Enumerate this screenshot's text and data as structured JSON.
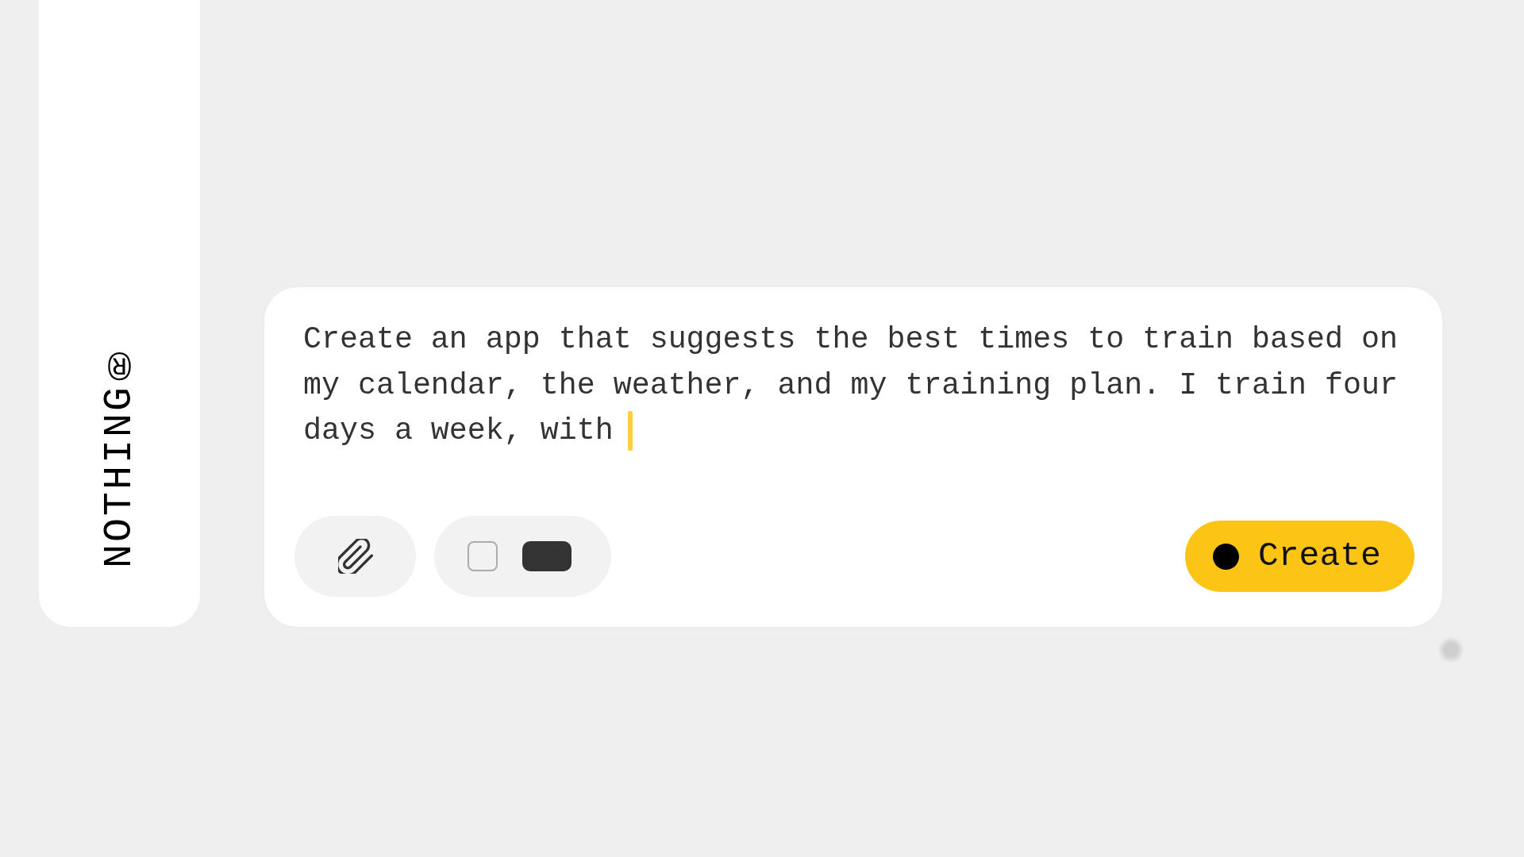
{
  "sidebar": {
    "logo": "NOTHING®"
  },
  "prompt": {
    "value": "Create an app that suggests the best times to train based on my calendar, the weather, and my training plan. I train four days a week, with",
    "focused": true
  },
  "toolbar": {
    "view_toggle": [
      {
        "selected": false
      },
      {
        "selected": true
      }
    ],
    "create_button": "Create"
  }
}
